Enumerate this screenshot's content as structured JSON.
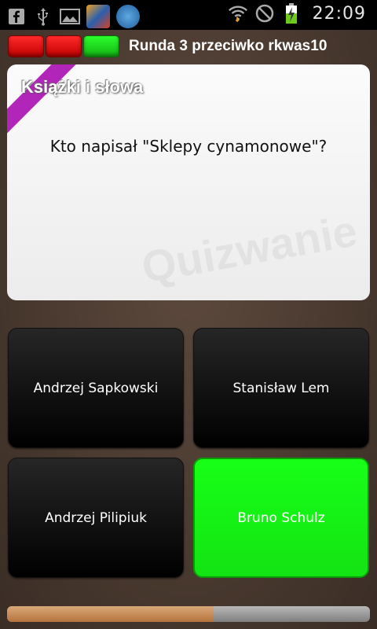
{
  "status_bar": {
    "time": "22:09",
    "icons": [
      "facebook-icon",
      "usb-icon",
      "gallery-icon",
      "app-icon",
      "app-icon",
      "wifi-icon",
      "no-signal-icon",
      "battery-charging-icon"
    ]
  },
  "round": {
    "label": "Runda 3 przeciwko rkwas10",
    "progress": [
      "incorrect",
      "incorrect",
      "correct"
    ],
    "colors": {
      "incorrect": "#e01010",
      "correct": "#1ed81e"
    }
  },
  "question_card": {
    "category": "Książki i słowa",
    "question": "Kto napisał \"Sklepy cynamonowe\"?",
    "watermark": "Quizwanie",
    "ribbon_color": "#b225b9"
  },
  "answers": [
    {
      "label": "Andrzej Sapkowski",
      "state": "default"
    },
    {
      "label": "Stanisław Lem",
      "state": "default"
    },
    {
      "label": "Andrzej Pilipiuk",
      "state": "default"
    },
    {
      "label": "Bruno Schulz",
      "state": "correct"
    }
  ],
  "timer": {
    "remaining_fraction": 0.57,
    "fill_color": "#c88850"
  }
}
